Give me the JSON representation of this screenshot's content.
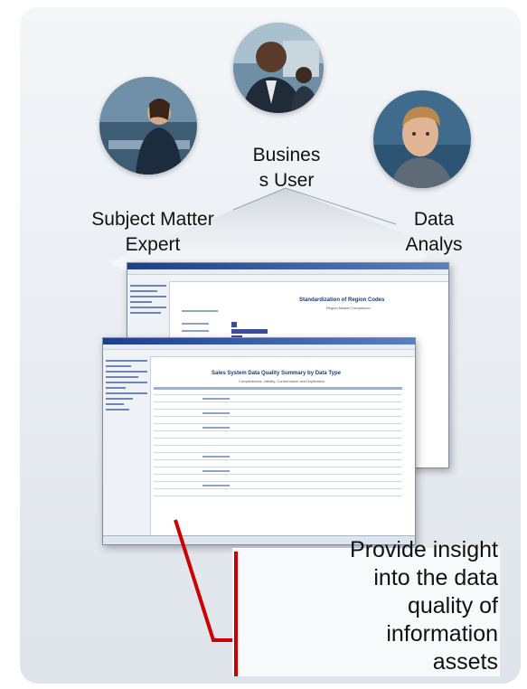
{
  "roles": {
    "business_user": "Busines\ns User",
    "subject_matter_expert": "Subject Matter\nExpert",
    "data_analyst": "Data\nAnalys\nt"
  },
  "screens": {
    "back_title": "Standardization of Region Codes",
    "front_title": "Sales System Data Quality Summary by Data Type"
  },
  "callout": {
    "text": "Provide insight\ninto the data\nquality of\ninformation\nassets"
  },
  "colors": {
    "accent_red": "#cc0000",
    "panel_bg": "#e8ecf1",
    "title_blue": "#1d3c78"
  }
}
